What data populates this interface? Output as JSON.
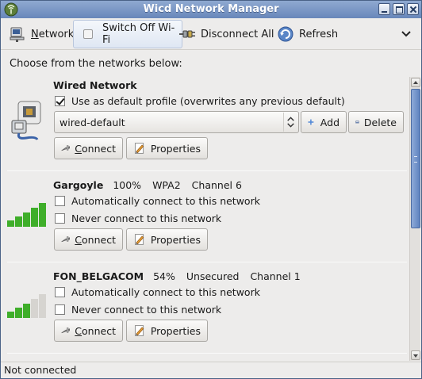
{
  "window": {
    "title": "Wicd Network Manager"
  },
  "toolbar": {
    "network_label_u": "N",
    "network_label_rest": "etwork",
    "wifi_label": "Switch Off Wi-Fi",
    "disconnect_label": "Disconnect All",
    "refresh_label": "Refresh"
  },
  "heading": "Choose from the networks below:",
  "wired": {
    "title": "Wired Network",
    "default_profile_label": "Use as default profile (overwrites any previous default)",
    "default_profile_checked": true,
    "profile_value": "wired-default",
    "add_label": "Add",
    "delete_label": "Delete",
    "connect_u": "C",
    "connect_rest": "onnect",
    "properties_label": "Properties"
  },
  "networks": [
    {
      "name": "Gargoyle",
      "strength": "100%",
      "security": "WPA2",
      "channel": "Channel 6",
      "signal_level": 1.0,
      "auto_connect_label": "Automatically connect to this network",
      "never_connect_label": "Never connect to this network",
      "connect_u": "C",
      "connect_rest": "onnect",
      "properties_label": "Properties"
    },
    {
      "name": "FON_BELGACOM",
      "strength": "54%",
      "security": "Unsecured",
      "channel": "Channel 1",
      "signal_level": 0.54,
      "auto_connect_label": "Automatically connect to this network",
      "never_connect_label": "Never connect to this network",
      "connect_u": "C",
      "connect_rest": "onnect",
      "properties_label": "Properties"
    }
  ],
  "statusbar": {
    "text": "Not connected"
  },
  "colors": {
    "signal_active": "#3fae2a",
    "signal_inactive": "#d6d4d0",
    "titlebar": "#7896c5"
  }
}
